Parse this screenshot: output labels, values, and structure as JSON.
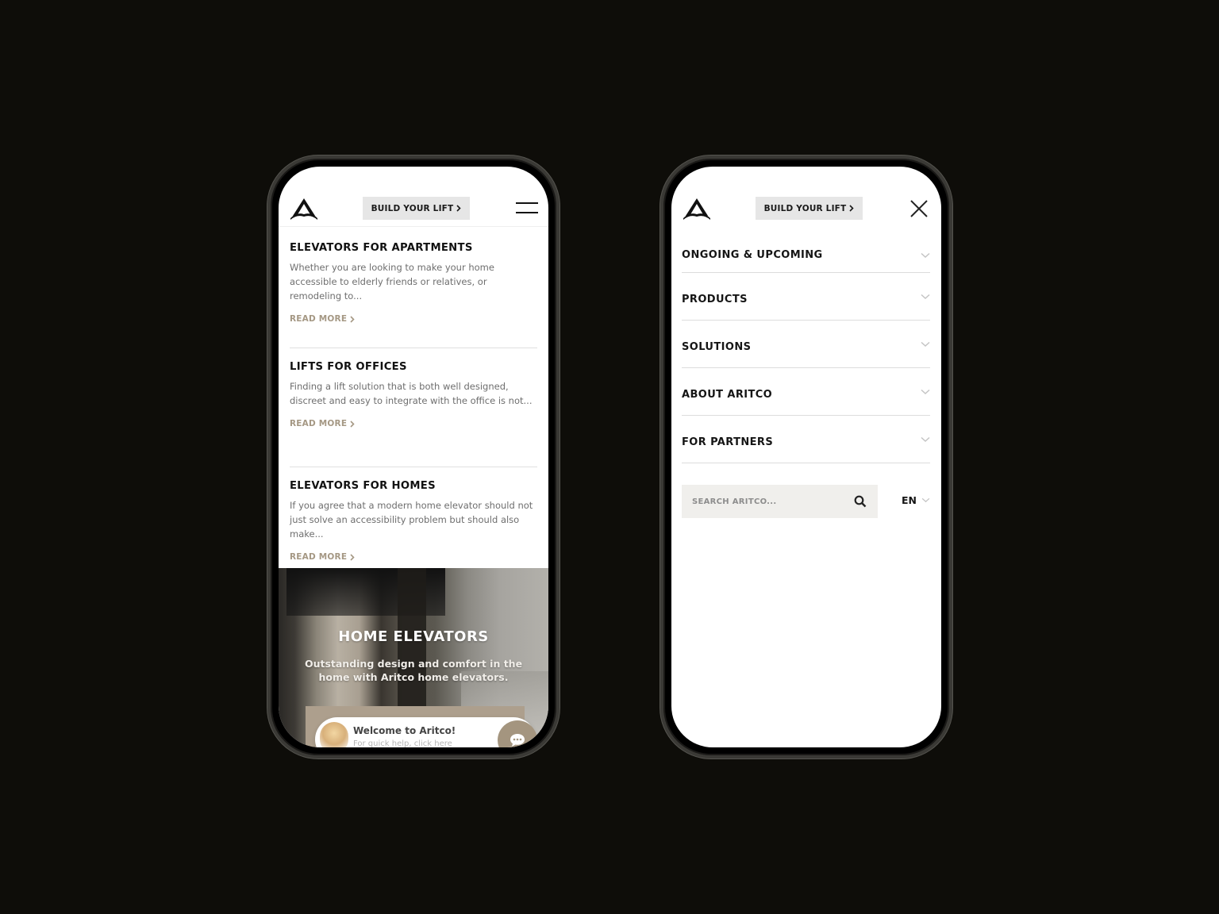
{
  "brand": {
    "name": "Aritco",
    "accent_color": "#a59884",
    "chat_color": "#a4957f"
  },
  "header": {
    "logo_icon": "aritco-logo-icon",
    "build_button_label": "BUILD YOUR LIFT",
    "build_button_icon": "chevron-right-icon",
    "menu_icon": "hamburger-icon",
    "close_icon": "close-icon"
  },
  "left_phone": {
    "articles": [
      {
        "title": "ELEVATORS FOR APARTMENTS",
        "excerpt": "Whether you are looking to make your home accessible to elderly friends or relatives, or remodeling to...",
        "link_label": "READ MORE"
      },
      {
        "title": "LIFTS FOR OFFICES",
        "excerpt": "Finding a lift solution that is both well designed, discreet and easy to integrate with the office is not...",
        "link_label": "READ MORE"
      },
      {
        "title": "ELEVATORS FOR HOMES",
        "excerpt": "If you agree that a modern home elevator should not just solve an accessibility problem but should also make...",
        "link_label": "READ MORE"
      }
    ],
    "hero": {
      "title": "HOME ELEVATORS",
      "subtitle": "Outstanding design and comfort in the home with Aritco home elevators."
    },
    "chat": {
      "title": "Welcome to Aritco!",
      "subtitle": "For quick help, click here",
      "icon": "chat-bubble-icon"
    }
  },
  "right_phone": {
    "menu_items": [
      {
        "label": "ONGOING & UPCOMING",
        "icon": "chevron-down-icon"
      },
      {
        "label": "PRODUCTS",
        "icon": "chevron-down-icon"
      },
      {
        "label": "SOLUTIONS",
        "icon": "chevron-down-icon"
      },
      {
        "label": "ABOUT ARITCO",
        "icon": "chevron-down-icon"
      },
      {
        "label": "FOR PARTNERS",
        "icon": "chevron-down-icon"
      }
    ],
    "search": {
      "placeholder": "SEARCH ARITCO...",
      "value": "",
      "icon": "search-icon"
    },
    "language": {
      "selected": "EN",
      "icon": "chevron-down-icon"
    }
  }
}
